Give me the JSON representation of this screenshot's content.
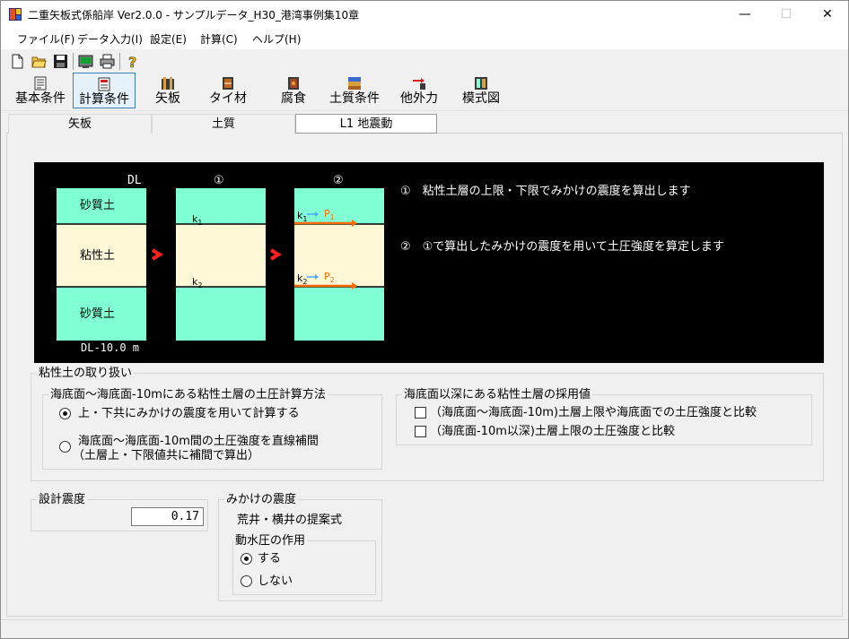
{
  "window": {
    "title": "二重矢板式係船岸 Ver2.0.0 - サンプルデータ_H30_港湾事例集10章",
    "minimize": "—",
    "maximize": "☐",
    "close": "✕"
  },
  "menu": [
    "ファイル(F)",
    "データ入力(I)",
    "設定(E)",
    "計算(C)",
    "ヘルプ(H)"
  ],
  "toolbar_small": [
    "new-file-icon",
    "open-folder-icon",
    "save-icon",
    "calculator-icon",
    "print-icon",
    "help-icon"
  ],
  "toolbar_big": [
    {
      "label": "基本条件",
      "icon": "document-icon"
    },
    {
      "label": "計算条件",
      "icon": "calc-sheet-icon"
    },
    {
      "label": "矢板",
      "icon": "sheet-pile-icon"
    },
    {
      "label": "タイ材",
      "icon": "tie-rod-icon"
    },
    {
      "label": "腐食",
      "icon": "corrosion-icon"
    },
    {
      "label": "土質条件",
      "icon": "soil-icon"
    },
    {
      "label": "他外力",
      "icon": "external-force-icon"
    },
    {
      "label": "模式図",
      "icon": "schematic-icon"
    }
  ],
  "tabs": [
    "矢板",
    "土質",
    "L1 地震動"
  ],
  "selected_tab": "L1 地震動",
  "diagram": {
    "dl_top": "DL",
    "dl_bottom": "DL-10.0 m",
    "col2_num": "①",
    "col3_num": "②",
    "sand_label": "砂質土",
    "clay_label": "粘性土",
    "k1": "k",
    "k1_sub": "1",
    "k2": "k",
    "k2_sub": "2",
    "p1": "P",
    "p1_sub": "1",
    "p2": "P",
    "p2_sub": "2",
    "note1": "①　粘性土層の上限・下限でみかけの震度を算出します",
    "note2": "②　①で算出したみかけの震度を用いて土圧強度を算定します",
    "colors": {
      "sand": "#80ffd4",
      "clay": "#fff8d6",
      "arrow_red": "#ff2020",
      "arrow_orange": "#ff6a00",
      "arrow_blue": "#4da6ff"
    }
  },
  "clay_handling": {
    "title": "粘性土の取り扱い",
    "method_title": "海底面～海底面-10mにある粘性土層の土圧計算方法",
    "option1": "上・下共にみかけの震度を用いて計算する",
    "option2_line1": "海底面～海底面-10m間の土圧強度を直線補間",
    "option2_line2": "（土層上・下限値共に補間で算出）",
    "selected_option": 1,
    "adopted_title": "海底面以深にある粘性土層の採用値",
    "check1": "（海底面～海底面-10m)土層上限や海底面での土圧強度と比較",
    "check2": "（海底面-10m以深)土層上限の土圧強度と比較",
    "check1_value": false,
    "check2_value": false
  },
  "design_seismic": {
    "title": "設計震度",
    "value": "0.17"
  },
  "apparent_seismic": {
    "title": "みかけの震度",
    "formula": "荒井・横井の提案式",
    "hydro_title": "動水圧の作用",
    "opt_yes": "する",
    "opt_no": "しない",
    "selected": "する"
  }
}
